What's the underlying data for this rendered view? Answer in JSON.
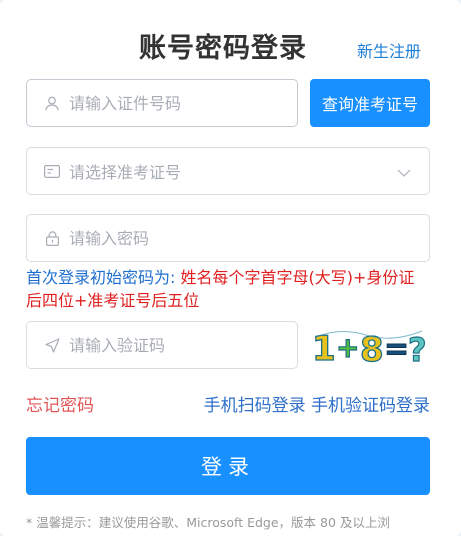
{
  "header": {
    "title": "账号密码登录",
    "register_link": "新生注册"
  },
  "form": {
    "id_placeholder": "请输入证件号码",
    "query_button": "查询准考证号",
    "exam_select_placeholder": "请选择准考证号",
    "password_placeholder": "请输入密码",
    "notice_prefix": "首次登录初始密码为: ",
    "notice_rule": "姓名每个字首字母(大写)+身份证后四位+准考证号后五位",
    "captcha_placeholder": "请输入验证码",
    "captcha_text": "1+8=?"
  },
  "links": {
    "forgot_password": "忘记密码",
    "scan_login": "手机扫码登录",
    "sms_login": "手机验证码登录"
  },
  "login_button": "登录",
  "tip": "* 温馨提示：建议使用谷歌、Microsoft Edge，版本 80 及以上浏",
  "colors": {
    "primary": "#1890ff",
    "link": "#2d6ec9",
    "danger": "#e02020",
    "forgot": "#e05555"
  },
  "icons": [
    "user-icon",
    "id-card-icon",
    "chevron-down-icon",
    "lock-icon",
    "send-icon"
  ]
}
